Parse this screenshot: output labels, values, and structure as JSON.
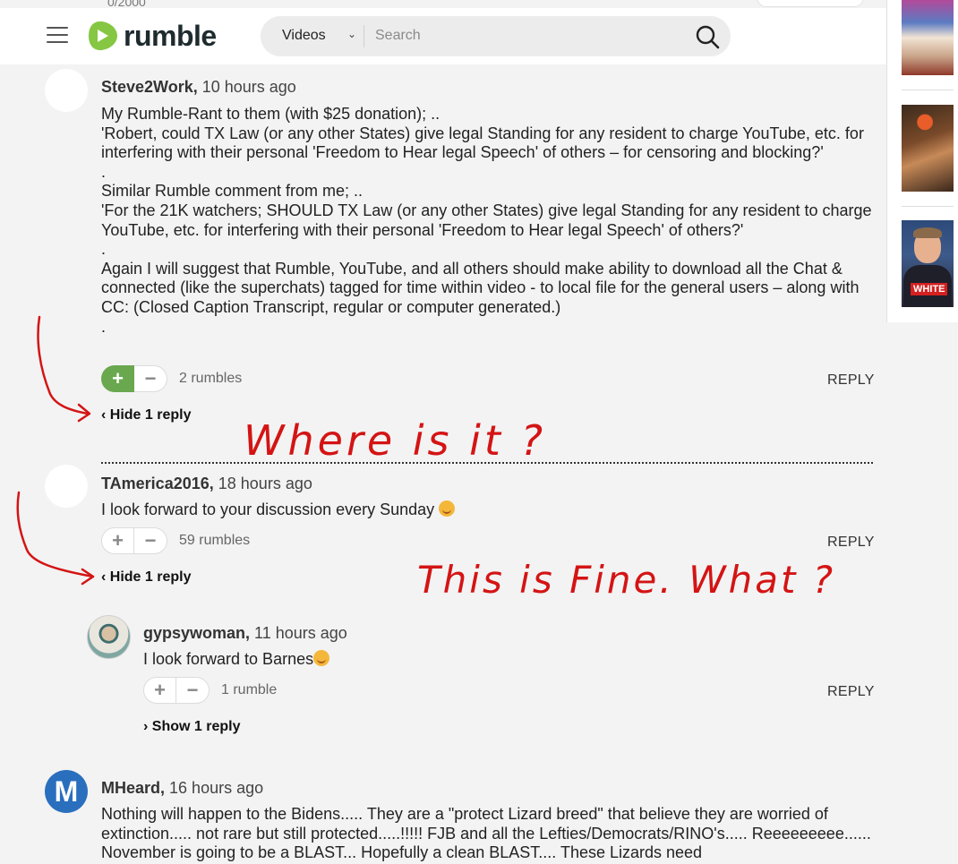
{
  "top_strip": {
    "char_count": "0/2000"
  },
  "header": {
    "logo_text": "rumble",
    "search_type": "Videos",
    "search_placeholder": "Search"
  },
  "colors": {
    "brand_green": "#85c742",
    "upvote_green": "#6aa84f",
    "annotation_red": "#d41414",
    "avatar_blue": "#2a6fbe"
  },
  "comments": [
    {
      "author": "Steve2Work,",
      "time": "10 hours ago",
      "lines": [
        "My Rumble-Rant to them (with $25 donation); ..",
        "'Robert, could TX Law (or any other States) give legal Standing for any resident to charge YouTube, etc. for interfering with their personal 'Freedom to Hear legal Speech' of others – for censoring and blocking?'",
        ".",
        "Similar Rumble comment from me; ..",
        "'For the 21K watchers; SHOULD TX Law (or any other States) give legal Standing for any resident to charge YouTube, etc. for interfering with their personal 'Freedom to Hear legal Speech' of others?'",
        ".",
        "Again I will suggest that Rumble, YouTube, and all others should make ability to download all the Chat & connected (like the superchats) tagged for time within video - to local file for the general users – along with CC: (Closed Caption Transcript, regular or computer generated.)",
        "."
      ],
      "rumbles": "2 rumbles",
      "reply": "REPLY",
      "toggle": "‹ Hide 1 reply"
    },
    {
      "author": "TAmerica2016,",
      "time": "18 hours ago",
      "text": "I look forward to your discussion every Sunday",
      "rumbles": "59 rumbles",
      "reply": "REPLY",
      "toggle": "‹ Hide 1 reply"
    },
    {
      "author": "gypsywoman,",
      "time": "11 hours ago",
      "text": "I look forward to Barnes",
      "rumbles": "1 rumble",
      "reply": "REPLY",
      "toggle": "› Show 1 reply"
    },
    {
      "author": "MHeard,",
      "time": "16 hours ago",
      "avatar_letter": "M",
      "text": "Nothing will happen to the Bidens..... They are a \"protect Lizard breed\" that believe they are worried of extinction..... not rare but still protected.....!!!!! FJB and all the Lefties/Democrats/RINO's..... Reeeeeeeee...... November is going to be a BLAST... Hopefully a clean BLAST.... These Lizards need"
    }
  ],
  "sidebar": {
    "thumb3_tag": "WHITE"
  },
  "annotations": {
    "question1": "Where is it ?",
    "question2": "This is Fine. What ?"
  }
}
